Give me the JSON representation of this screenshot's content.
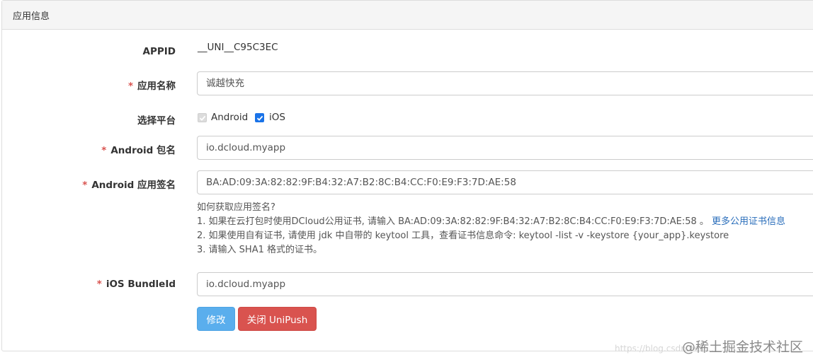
{
  "panel": {
    "title": "应用信息"
  },
  "form": {
    "appid": {
      "label": "APPID",
      "value": "__UNI__C95C3EC"
    },
    "app_name": {
      "required": "*",
      "label": "应用名称",
      "value": "诚越快充"
    },
    "platform": {
      "label": "选择平台",
      "options": [
        {
          "label": "Android",
          "checked": true,
          "disabled": true
        },
        {
          "label": "iOS",
          "checked": true,
          "disabled": false
        }
      ]
    },
    "android_package": {
      "required": "*",
      "label": "Android 包名",
      "value": "io.dcloud.myapp"
    },
    "android_signature": {
      "required": "*",
      "label": "Android 应用签名",
      "value": "BA:AD:09:3A:82:82:9F:B4:32:A7:B2:8C:B4:CC:F0:E9:F3:7D:AE:58",
      "help": {
        "title": "如何获取应用签名?",
        "line1": "1. 如果在云打包时使用DCloud公用证书, 请输入 BA:AD:09:3A:82:82:9F:B4:32:A7:B2:8C:B4:CC:F0:E9:F3:7D:AE:58 。",
        "line1_link": "更多公用证书信息",
        "line2": "2. 如果使用自有证书, 请使用 jdk 中自带的 keytool 工具，查看证书信息命令: keytool -list -v -keystore {your_app}.keystore",
        "line3": "3. 请输入 SHA1 格式的证书。"
      }
    },
    "ios_bundle": {
      "required": "*",
      "label": "iOS BundleId",
      "value": "io.dcloud.myapp"
    }
  },
  "buttons": {
    "modify": "修改",
    "close_unipush": "关闭 UniPush"
  },
  "watermark": {
    "text": "@稀土掘金技术社区",
    "url": "https://blog.csdn.net/..."
  },
  "colors": {
    "primary": "#5aaeed",
    "danger": "#d9534f",
    "link": "#2a6ebb",
    "required": "#d9534f",
    "checkbox": "#1a73e8"
  }
}
